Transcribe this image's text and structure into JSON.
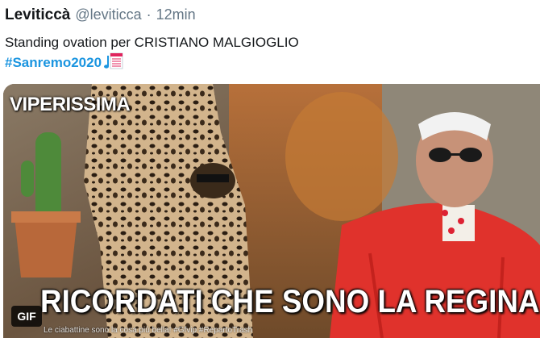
{
  "tweet": {
    "display_name": "Leviticcà",
    "handle": "@leviticca",
    "separator": "·",
    "time": "12min",
    "text": "Standing ovation per CRISTIANO MALGIOGLIO",
    "hashtag": "#Sanremo2020",
    "emoji_icon": "music-score-icon"
  },
  "media": {
    "type": "gif",
    "badge": "GIF",
    "watermark": "VIPERISSIMA",
    "caption": "RICORDATI CHE SONO LA REGINA",
    "ticker": "Le ciabattine sono la cosa più bella! #Gfvip #RepartoTrash"
  },
  "colors": {
    "hashtag": "#1b95e0",
    "muted": "#657786",
    "text": "#14171a"
  }
}
